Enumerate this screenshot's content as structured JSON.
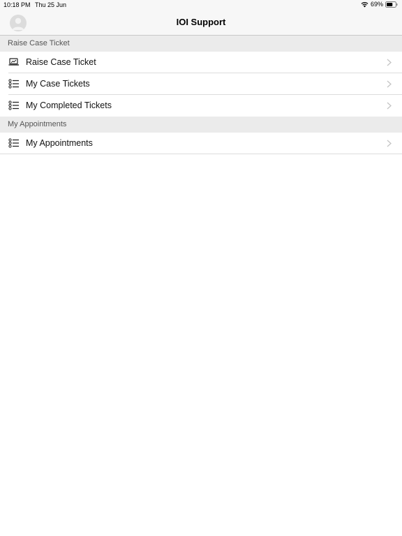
{
  "status_bar": {
    "time": "10:18 PM",
    "date": "Thu 25 Jun",
    "battery": "69%"
  },
  "nav": {
    "title": "IOI Support"
  },
  "sections": [
    {
      "header": "Raise Case Ticket",
      "rows": [
        {
          "label": "Raise Case Ticket",
          "icon": "laptop-icon"
        },
        {
          "label": "My Case Tickets",
          "icon": "list-icon"
        },
        {
          "label": "My Completed Tickets",
          "icon": "list-icon"
        }
      ]
    },
    {
      "header": "My Appointments",
      "rows": [
        {
          "label": "My Appointments",
          "icon": "list-icon"
        }
      ]
    }
  ],
  "colors": {
    "nav_background": "#f7f7f7",
    "section_background": "#ebebeb",
    "chevron": "#c4c4c4"
  }
}
